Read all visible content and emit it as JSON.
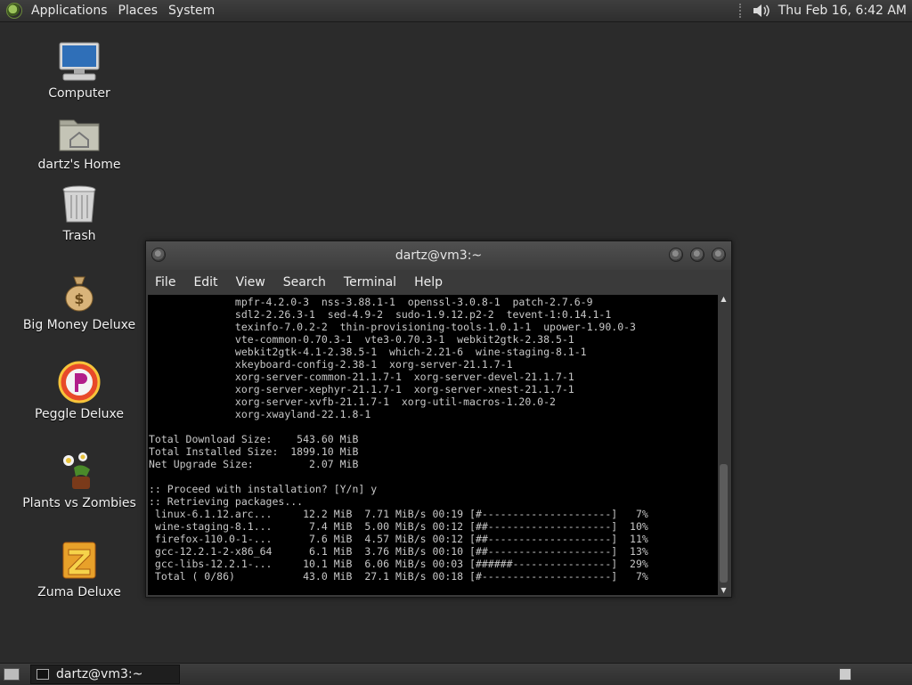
{
  "top_panel": {
    "menus": [
      "Applications",
      "Places",
      "System"
    ],
    "clock": "Thu Feb 16,  6:42 AM",
    "icons": [
      "distro-logo-icon",
      "volume-icon"
    ]
  },
  "desktop": {
    "icons": [
      {
        "label": "Computer",
        "icon": "computer-icon"
      },
      {
        "label": "dartz's Home",
        "icon": "home-folder-icon"
      },
      {
        "label": "Trash",
        "icon": "trash-icon"
      },
      {
        "label": "Big Money Deluxe",
        "icon": "money-bag-icon"
      },
      {
        "label": "Peggle Deluxe",
        "icon": "peggle-icon"
      },
      {
        "label": "Plants vs Zombies",
        "icon": "plants-vs-zombies-icon"
      },
      {
        "label": "Zuma Deluxe",
        "icon": "zuma-icon"
      }
    ]
  },
  "terminal": {
    "title": "dartz@vm3:~",
    "menu": [
      "File",
      "Edit",
      "View",
      "Search",
      "Terminal",
      "Help"
    ],
    "lines": [
      "              mpfr-4.2.0-3  nss-3.88.1-1  openssl-3.0.8-1  patch-2.7.6-9",
      "              sdl2-2.26.3-1  sed-4.9-2  sudo-1.9.12.p2-2  tevent-1:0.14.1-1",
      "              texinfo-7.0.2-2  thin-provisioning-tools-1.0.1-1  upower-1.90.0-3",
      "              vte-common-0.70.3-1  vte3-0.70.3-1  webkit2gtk-2.38.5-1",
      "              webkit2gtk-4.1-2.38.5-1  which-2.21-6  wine-staging-8.1-1",
      "              xkeyboard-config-2.38-1  xorg-server-21.1.7-1",
      "              xorg-server-common-21.1.7-1  xorg-server-devel-21.1.7-1",
      "              xorg-server-xephyr-21.1.7-1  xorg-server-xnest-21.1.7-1",
      "              xorg-server-xvfb-21.1.7-1  xorg-util-macros-1.20.0-2",
      "              xorg-xwayland-22.1.8-1",
      "",
      "Total Download Size:    543.60 MiB",
      "Total Installed Size:  1899.10 MiB",
      "Net Upgrade Size:         2.07 MiB",
      "",
      ":: Proceed with installation? [Y/n] y",
      ":: Retrieving packages...",
      " linux-6.1.12.arc...     12.2 MiB  7.71 MiB/s 00:19 [#---------------------]   7%",
      " wine-staging-8.1...      7.4 MiB  5.00 MiB/s 00:12 [##--------------------]  10%",
      " firefox-110.0-1-...      7.6 MiB  4.57 MiB/s 00:12 [##--------------------]  11%",
      " gcc-12.2.1-2-x86_64      6.1 MiB  3.76 MiB/s 00:10 [##--------------------]  13%",
      " gcc-libs-12.2.1-...     10.1 MiB  6.06 MiB/s 00:03 [######----------------]  29%",
      " Total ( 0/86)           43.0 MiB  27.1 MiB/s 00:18 [#---------------------]   7%"
    ],
    "scroll_up": "▲",
    "scroll_down": "▼"
  },
  "bottom_panel": {
    "task_label": "dartz@vm3:~"
  }
}
